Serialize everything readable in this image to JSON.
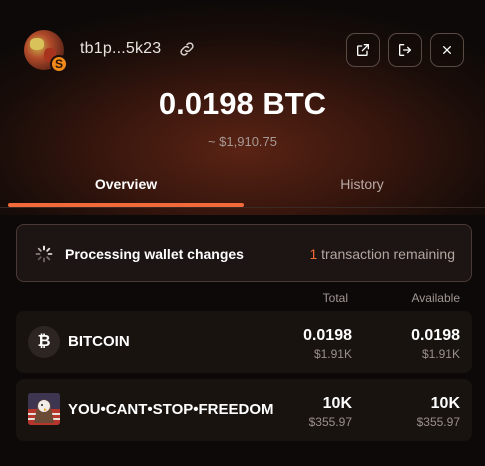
{
  "wallet": {
    "address": "tb1p...5k23",
    "avatar_badge": "S"
  },
  "balance": {
    "amount": "0.0198 BTC",
    "fiat": "~ $1,910.75"
  },
  "tabs": [
    {
      "label": "Overview",
      "active": true
    },
    {
      "label": "History",
      "active": false
    }
  ],
  "banner": {
    "text": "Processing wallet changes",
    "count": "1",
    "remaining_text": " transaction remaining"
  },
  "columns": {
    "total": "Total",
    "available": "Available"
  },
  "tokens": [
    {
      "icon_glyph": "₿",
      "icon": "bitcoin-icon",
      "name": "BITCOIN",
      "total": "0.0198",
      "total_fiat": "$1.91K",
      "available": "0.0198",
      "available_fiat": "$1.91K"
    },
    {
      "icon": "rune-image",
      "name": "YOU•CANT•STOP•FREEDOM",
      "total": "10K",
      "total_fiat": "$355.97",
      "available": "10K",
      "available_fiat": "$355.97"
    }
  ],
  "colors": {
    "accent": "#f26a3a",
    "background": "#0c0908"
  }
}
